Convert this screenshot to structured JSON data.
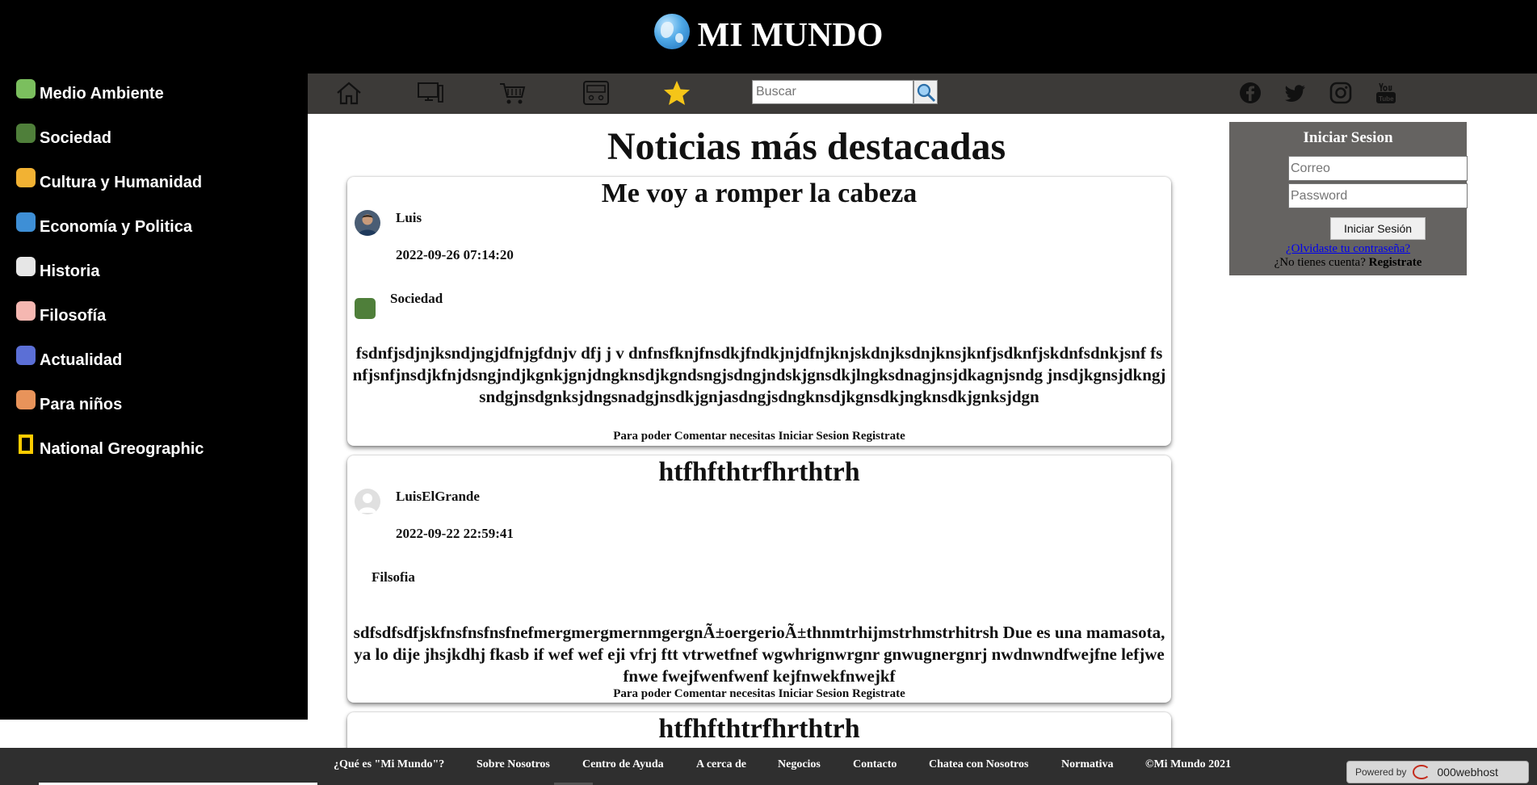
{
  "header": {
    "title": "MI MUNDO",
    "logo_icon": "globe-icon"
  },
  "sidebar": {
    "items": [
      {
        "label": "Medio Ambiente",
        "icon": "tree-icon",
        "color": "#7bbf5e"
      },
      {
        "label": "Sociedad",
        "icon": "people-icon",
        "color": "#4f7f3a"
      },
      {
        "label": "Cultura y Humanidad",
        "icon": "theater-masks-icon",
        "color": "#f2b233"
      },
      {
        "label": "Economía y Politica",
        "icon": "globe-money-icon",
        "color": "#3e8fd6"
      },
      {
        "label": "Historia",
        "icon": "column-icon",
        "color": "#e6e6e6"
      },
      {
        "label": "Filosofía",
        "icon": "thinker-icon",
        "color": "#f5b7b1"
      },
      {
        "label": "Actualidad",
        "icon": "network-icon",
        "color": "#5b6fd6"
      },
      {
        "label": "Para niños",
        "icon": "children-icon",
        "color": "#e8935a"
      },
      {
        "label": "National Greographic",
        "icon": "natgeo-frame-icon",
        "color": "#ffcc00"
      }
    ]
  },
  "navbar": {
    "buttons": [
      "home-icon",
      "computer-icon",
      "cart-icon",
      "console-icon",
      "star-icon"
    ],
    "search_placeholder": "Buscar",
    "social": [
      "facebook-icon",
      "twitter-icon",
      "instagram-icon",
      "youtube-icon"
    ]
  },
  "main": {
    "heading": "Noticias más destacadas",
    "posts": [
      {
        "title": "Me voy a romper la cabeza",
        "author": "Luis",
        "date": "2022-09-26 07:14:20",
        "category": "Sociedad",
        "body": "fsdnfjsdjnjksndjngjdfnjgfdnjv dfj j v dnfnsfknjfnsdkjfndkjnjdfnjknjskdnjksdnjknsjknfjsdknfjskdnfsdnkjsnf fsnfjsnfjnsdjkfnjdsngjndjkgnkjgnjdngknsdjkgndsngjsdngjndskjgnsdkjlngksdnagjnsjdkagnjsndg jnsdjkgnsjdkngjsndgjnsdgnksjdngsnadgjnsdkjgnjasdngjsdngknsdjkgnsdkjngknsdkjgnksjdgn",
        "comment_note": "Para poder Comentar necesitas Iniciar Sesion Registrate"
      },
      {
        "title": "htfhfthtrfhrthtrh",
        "author": "LuisElGrande",
        "date": "2022-09-22 22:59:41",
        "category": "Filsofia",
        "body": "sdfsdfsdfjskfnsfnsfnsfnefmergmergmernmgergnÃ±oergerioÃ±thnmtrhijmstrhmstrhitrsh Due es una mamasota, ya lo dije jhsjkdhj fkasb if wef wef eji vfrj ftt vtrwetfnef wgwhrignwrgnr gnwugnergnrj nwdnwndfwejfne lefjwefnwe fwejfwenfwenf kejfnwekfnwejkf",
        "comment_note": "Para poder Comentar necesitas Iniciar Sesion Registrate"
      },
      {
        "title": "htfhfthtrfhrthtrh"
      }
    ]
  },
  "login": {
    "title": "Iniciar Sesion",
    "email_placeholder": "Correo",
    "password_placeholder": "Password",
    "button": "Iniciar Sesión",
    "forgot": "¿Olvidaste tu contraseña?",
    "no_account": "¿No tienes cuenta?",
    "register": "Registrate"
  },
  "footer": {
    "links": [
      "¿Qué es \"Mi Mundo\"?",
      "Sobre Nosotros",
      "Centro de Ayuda",
      "A cerca de",
      "Negocios",
      "Contacto",
      "Chatea con Nosotros",
      "Normativa",
      "©Mi Mundo 2021"
    ],
    "powered_label": "Powered by",
    "powered_brand": "000webhost"
  }
}
